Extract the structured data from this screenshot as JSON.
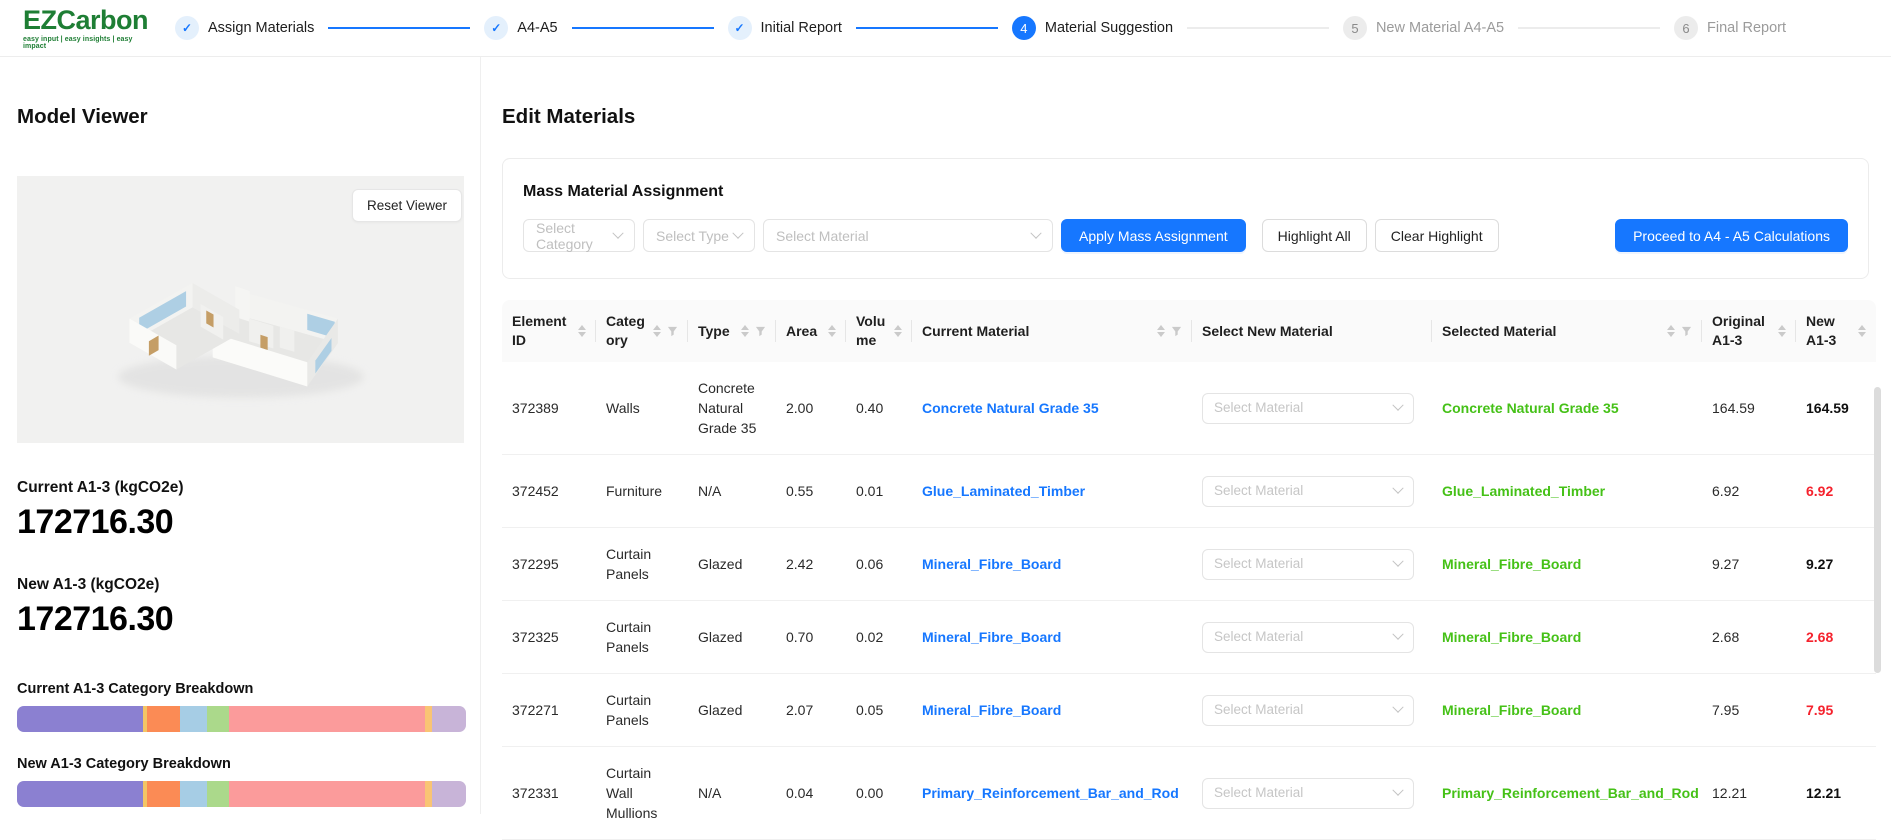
{
  "brand": {
    "name": "EZCarbon",
    "tagline": "easy input | easy insights | easy impact"
  },
  "colors": {
    "accent_blue": "#1677ff",
    "brand_green": "#1e7e34",
    "material_green": "#45c117",
    "alert_red": "#f5222d"
  },
  "stepper": {
    "steps": [
      {
        "label": "Assign Materials",
        "status": "done"
      },
      {
        "label": "A4-A5",
        "status": "done"
      },
      {
        "label": "Initial Report",
        "status": "done"
      },
      {
        "label": "Material Suggestion",
        "status": "current",
        "number": "4"
      },
      {
        "label": "New Material A4-A5",
        "status": "pending",
        "number": "5"
      },
      {
        "label": "Final Report",
        "status": "pending",
        "number": "6"
      }
    ]
  },
  "viewer": {
    "title": "Model Viewer",
    "reset_button": "Reset Viewer"
  },
  "metrics": {
    "current": {
      "label": "Current A1-3 (kgCO2e)",
      "value": "172716.30"
    },
    "new": {
      "label": "New A1-3 (kgCO2e)",
      "value": "172716.30"
    },
    "breakdown": {
      "current_label": "Current A1-3 Category Breakdown",
      "new_label": "New A1-3 Category Breakdown",
      "type": "stacked-bar",
      "note": "current and new bars are identical",
      "segments": [
        {
          "color": "#8b80d1",
          "pct": 28.1
        },
        {
          "color": "#f3c565",
          "pct": 0.8
        },
        {
          "color": "#fb8b55",
          "pct": 7.5
        },
        {
          "color": "#a6cde5",
          "pct": 6.0
        },
        {
          "color": "#abd98b",
          "pct": 4.9
        },
        {
          "color": "#fb9b9b",
          "pct": 43.6
        },
        {
          "color": "#f9c474",
          "pct": 1.6
        },
        {
          "color": "#c8b4d8",
          "pct": 7.5
        }
      ]
    }
  },
  "edit": {
    "title": "Edit Materials",
    "mass": {
      "title": "Mass Material Assignment",
      "selects": [
        {
          "placeholder": "Select Category"
        },
        {
          "placeholder": "Select Type"
        },
        {
          "placeholder": "Select Material"
        }
      ],
      "apply": "Apply Mass Assignment",
      "highlight": "Highlight All",
      "clear": "Clear Highlight",
      "proceed": "Proceed to A4 - A5 Calculations"
    },
    "table": {
      "select_placeholder": "Select Material",
      "columns": [
        {
          "key": "eid",
          "label": "Element ID",
          "sort": true,
          "filter": false
        },
        {
          "key": "cat",
          "label": "Category",
          "sort": true,
          "filter": true
        },
        {
          "key": "type",
          "label": "Type",
          "sort": true,
          "filter": true
        },
        {
          "key": "area",
          "label": "Area",
          "sort": true,
          "filter": false
        },
        {
          "key": "vol",
          "label": "Volume",
          "sort": true,
          "filter": false
        },
        {
          "key": "cur",
          "label": "Current Material",
          "sort": true,
          "filter": true
        },
        {
          "key": "sel",
          "label": "Select New Material",
          "sort": false,
          "filter": false
        },
        {
          "key": "seld",
          "label": "Selected Material",
          "sort": true,
          "filter": true
        },
        {
          "key": "orig",
          "label": "Original A1-3",
          "sort": true,
          "filter": false
        },
        {
          "key": "new",
          "label": "New A1-3",
          "sort": true,
          "filter": false
        }
      ],
      "rows": [
        {
          "element_id": "372389",
          "category": "Walls",
          "type": "Concrete Natural Grade 35",
          "area": "2.00",
          "volume": "0.40",
          "current_material": "Concrete Natural Grade 35",
          "selected_material": "Concrete Natural Grade 35",
          "original_a13": "164.59",
          "new_a13": "164.59",
          "new_a13_red": false
        },
        {
          "element_id": "372452",
          "category": "Furniture",
          "type": "N/A",
          "area": "0.55",
          "volume": "0.01",
          "current_material": "Glue_Laminated_Timber",
          "selected_material": "Glue_Laminated_Timber",
          "original_a13": "6.92",
          "new_a13": "6.92",
          "new_a13_red": true
        },
        {
          "element_id": "372295",
          "category": "Curtain Panels",
          "type": "Glazed",
          "area": "2.42",
          "volume": "0.06",
          "current_material": "Mineral_Fibre_Board",
          "selected_material": "Mineral_Fibre_Board",
          "original_a13": "9.27",
          "new_a13": "9.27",
          "new_a13_red": false
        },
        {
          "element_id": "372325",
          "category": "Curtain Panels",
          "type": "Glazed",
          "area": "0.70",
          "volume": "0.02",
          "current_material": "Mineral_Fibre_Board",
          "selected_material": "Mineral_Fibre_Board",
          "original_a13": "2.68",
          "new_a13": "2.68",
          "new_a13_red": true
        },
        {
          "element_id": "372271",
          "category": "Curtain Panels",
          "type": "Glazed",
          "area": "2.07",
          "volume": "0.05",
          "current_material": "Mineral_Fibre_Board",
          "selected_material": "Mineral_Fibre_Board",
          "original_a13": "7.95",
          "new_a13": "7.95",
          "new_a13_red": true
        },
        {
          "element_id": "372331",
          "category": "Curtain Wall Mullions",
          "type": "N/A",
          "area": "0.04",
          "volume": "0.00",
          "current_material": "Primary_Reinforcement_Bar_and_Rod",
          "selected_material": "Primary_Reinforcement_Bar_and_Rod",
          "original_a13": "12.21",
          "new_a13": "12.21",
          "new_a13_red": false
        }
      ]
    }
  }
}
